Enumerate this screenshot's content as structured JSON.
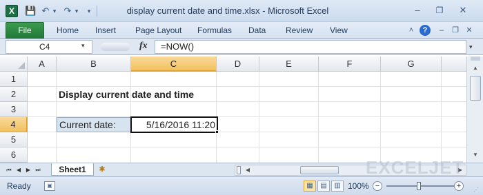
{
  "app": {
    "window_title": "display current date and time.xlsx - Microsoft Excel",
    "logo_letter": "X"
  },
  "icons": {
    "save": "💾",
    "undo": "↶",
    "redo": "↷",
    "qat_dropdown": "▾",
    "minimize": "–",
    "restore": "❐",
    "close": "✕",
    "ribbon_minimize": "˄",
    "help": "?",
    "doc_minimize": "–",
    "doc_restore": "❐",
    "doc_close": "✕",
    "dropdown_arrow": "▾",
    "expand": "▾",
    "nav_first": "⏮",
    "nav_prev": "◀",
    "nav_next": "▶",
    "nav_last": "⏭",
    "new_sheet": "✱",
    "scroll_up": "▲",
    "scroll_down": "▼",
    "scroll_left": "◀",
    "scroll_right": "▶",
    "normal_view": "▦",
    "page_layout_view": "▤",
    "page_break_view": "▥",
    "zoom_minus": "−",
    "zoom_plus": "+",
    "macro": "▣",
    "resize": "⋰"
  },
  "ribbon": {
    "file_label": "File",
    "tabs": [
      "Home",
      "Insert",
      "Page Layout",
      "Formulas",
      "Data",
      "Review",
      "View"
    ]
  },
  "formula_bar": {
    "name_box": "C4",
    "fx_label": "fx",
    "formula": "=NOW()"
  },
  "grid": {
    "columns": [
      "A",
      "B",
      "C",
      "D",
      "E",
      "F",
      "G"
    ],
    "active_column": "C",
    "rows": [
      "1",
      "2",
      "3",
      "4",
      "5",
      "6"
    ],
    "active_row": "4",
    "cells": {
      "B2": "Display current date and time",
      "B4": "Current date:",
      "C4": "5/16/2016 11:20"
    }
  },
  "sheets": {
    "tabs": [
      "Sheet1"
    ],
    "active": "Sheet1"
  },
  "watermark": "EXCELJET",
  "status": {
    "ready": "Ready",
    "zoom": "100%",
    "zoom_fraction": 1.0
  },
  "colors": {
    "file_tab": "#217a37",
    "active_header": "#f1c15f",
    "label_fill": "#d8e3f0"
  }
}
